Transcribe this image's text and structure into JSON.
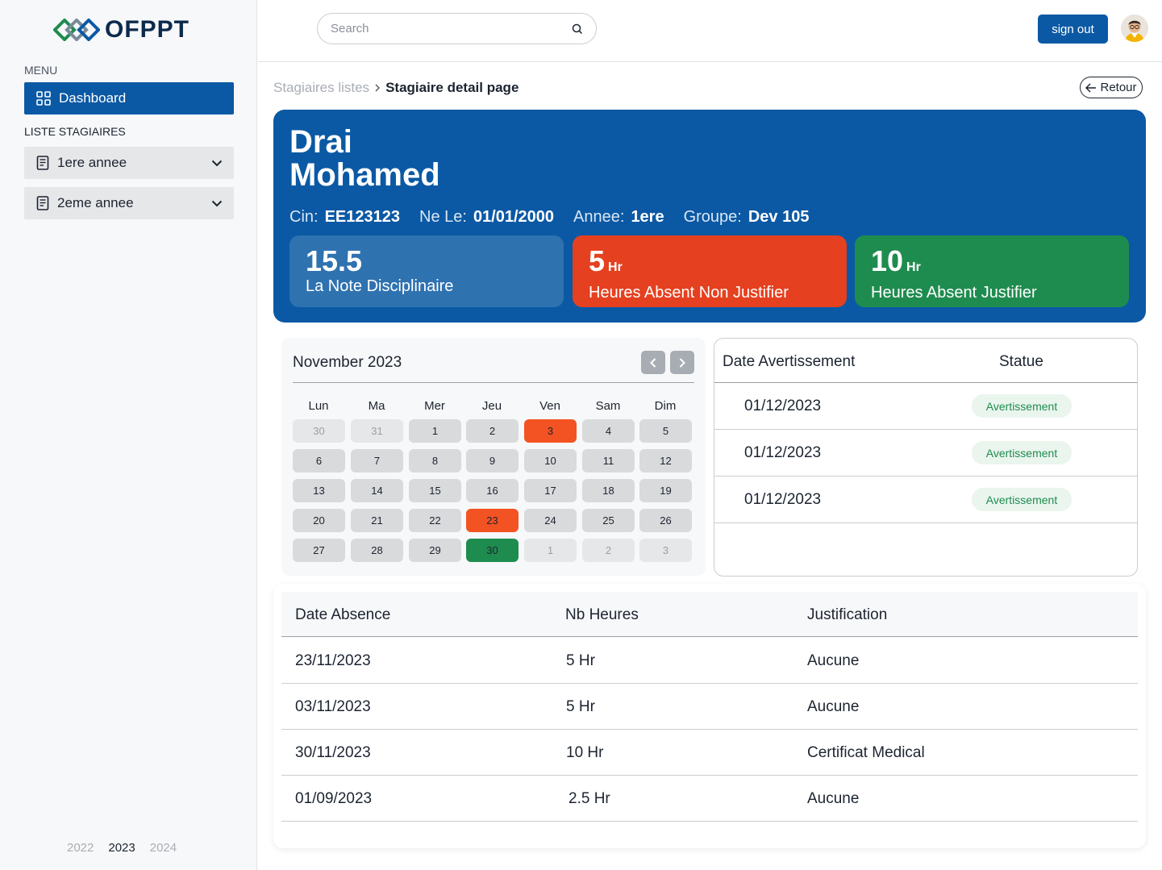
{
  "brand": {
    "name": "OFPPT"
  },
  "sidebar": {
    "menu_label": "MENU",
    "dashboard_label": "Dashboard",
    "list_label": "LISTE STAGIAIRES",
    "years": [
      "1ere annee",
      "2eme annee"
    ]
  },
  "footer_years": {
    "y1": "2022",
    "y2": "2023",
    "y3": "2024",
    "active": "2023"
  },
  "topbar": {
    "search_placeholder": "Search",
    "signout_label": "sign out"
  },
  "breadcrumb": {
    "prev": "Stagiaires listes",
    "sep": ">",
    "current": "Stagiaire detail page"
  },
  "retour_label": "Retour",
  "student": {
    "last_name": "Drai",
    "first_name": "Mohamed",
    "cin_label": "Cin:",
    "cin": "EE123123",
    "ne_label": "Ne Le:",
    "ne": "01/01/2000",
    "annee_label": "Annee:",
    "annee": "1ere",
    "groupe_label": "Groupe:",
    "groupe": "Dev 105"
  },
  "stats": {
    "note": {
      "value": "15.5",
      "label": "La Note Disciplinaire"
    },
    "non_justifie": {
      "value": "5",
      "unit": "Hr",
      "label": "Heures Absent Non Justifier"
    },
    "justifie": {
      "value": "10",
      "unit": "Hr",
      "label": "Heures Absent Justifier"
    }
  },
  "calendar": {
    "title": "November 2023",
    "weekdays": [
      "Lun",
      "Ma",
      "Mer",
      "Jeu",
      "Ven",
      "Sam",
      "Dim"
    ],
    "weeks": [
      [
        [
          "30",
          "muted"
        ],
        [
          "31",
          "muted"
        ],
        [
          "1",
          ""
        ],
        [
          "2",
          ""
        ],
        [
          "3",
          "red"
        ],
        [
          "4",
          ""
        ],
        [
          "5",
          ""
        ]
      ],
      [
        [
          "6",
          ""
        ],
        [
          "7",
          ""
        ],
        [
          "8",
          ""
        ],
        [
          "9",
          ""
        ],
        [
          "10",
          ""
        ],
        [
          "11",
          ""
        ],
        [
          "12",
          ""
        ]
      ],
      [
        [
          "13",
          ""
        ],
        [
          "14",
          ""
        ],
        [
          "15",
          ""
        ],
        [
          "16",
          ""
        ],
        [
          "17",
          ""
        ],
        [
          "18",
          ""
        ],
        [
          "19",
          ""
        ]
      ],
      [
        [
          "20",
          ""
        ],
        [
          "21",
          ""
        ],
        [
          "22",
          ""
        ],
        [
          "23",
          "red"
        ],
        [
          "24",
          ""
        ],
        [
          "25",
          ""
        ],
        [
          "26",
          ""
        ]
      ],
      [
        [
          "27",
          ""
        ],
        [
          "28",
          ""
        ],
        [
          "29",
          ""
        ],
        [
          "30",
          "green"
        ],
        [
          "1",
          "muted"
        ],
        [
          "2",
          "muted"
        ],
        [
          "3",
          "muted"
        ]
      ]
    ]
  },
  "warnings": {
    "header_date": "Date Avertissement",
    "header_status": "Statue",
    "rows": [
      {
        "date": "01/12/2023",
        "status": "Avertissement"
      },
      {
        "date": "01/12/2023",
        "status": "Avertissement"
      },
      {
        "date": "01/12/2023",
        "status": "Avertissement"
      }
    ]
  },
  "absences": {
    "headers": [
      "Date Absence",
      "Nb Heures",
      "Justification"
    ],
    "rows": [
      {
        "date": "23/11/2023",
        "hours": "5 Hr",
        "justification": "Aucune"
      },
      {
        "date": "03/11/2023",
        "hours": "5 Hr",
        "justification": "Aucune"
      },
      {
        "date": "30/11/2023",
        "hours": "10 Hr",
        "justification": "Certificat Medical"
      },
      {
        "date": "01/09/2023",
        "hours": "2.5 Hr",
        "justification": "Aucune"
      }
    ]
  },
  "colors": {
    "primary": "#0b59a4",
    "red": "#e5401f",
    "green": "#1f8c4f",
    "card_blue": "#2f72b0"
  }
}
